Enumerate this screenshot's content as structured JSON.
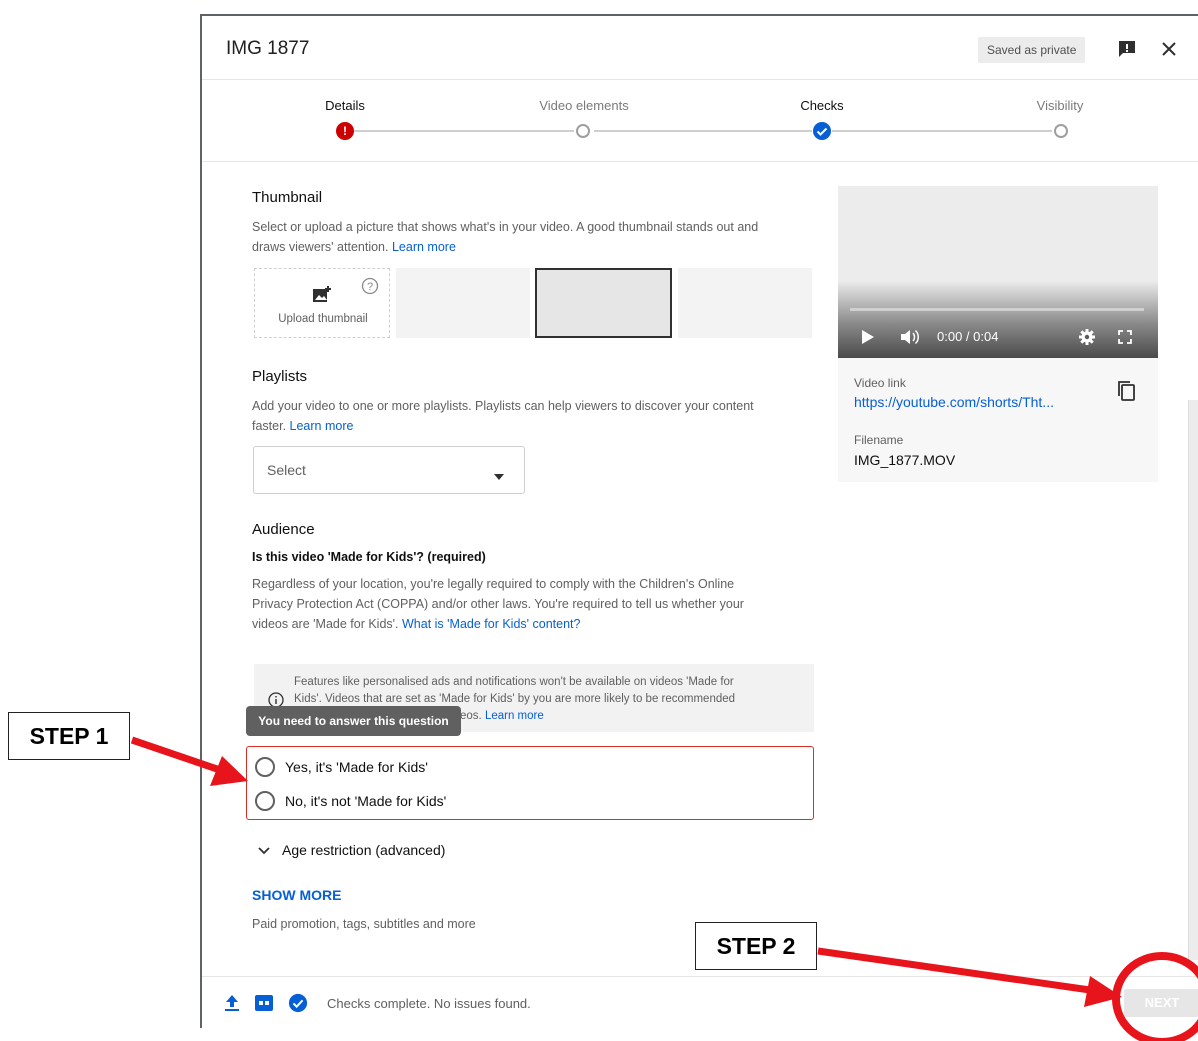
{
  "dialog": {
    "title": "IMG 1877",
    "saved_badge": "Saved as private"
  },
  "steps": [
    {
      "label": "Details",
      "state": "error"
    },
    {
      "label": "Video elements",
      "state": "pending"
    },
    {
      "label": "Checks",
      "state": "done"
    },
    {
      "label": "Visibility",
      "state": "pending"
    }
  ],
  "thumbnail": {
    "heading": "Thumbnail",
    "desc_line1": "Select or upload a picture that shows what's in your video. A good thumbnail stands out and",
    "desc_line2": "draws viewers' attention.",
    "learn_more": "Learn more",
    "upload_label": "Upload thumbnail"
  },
  "playlists": {
    "heading": "Playlists",
    "desc_line1": "Add your video to one or more playlists. Playlists can help viewers to discover your content",
    "desc_line2": "faster.",
    "learn_more": "Learn more",
    "select_placeholder": "Select"
  },
  "audience": {
    "heading": "Audience",
    "question": "Is this video 'Made for Kids'? (required)",
    "desc_line1": "Regardless of your location, you're legally required to comply with the Children's Online",
    "desc_line2": "Privacy Protection Act (COPPA) and/or other laws. You're required to tell us whether your",
    "desc_line3": "videos are 'Made for Kids'.",
    "what_is_link": "What is 'Made for Kids' content?",
    "info_line1": "Features like personalised ads and notifications won't be available on videos 'Made for",
    "info_line2": "Kids'. Videos that are set as 'Made for Kids' by you are more likely to be recommended",
    "info_line3_tail": "eos.",
    "info_learn_more": "Learn more",
    "tooltip": "You need to answer this question",
    "option_yes": "Yes, it's 'Made for Kids'",
    "option_no": "No, it's not 'Made for Kids'"
  },
  "age_restriction": "Age restriction (advanced)",
  "show_more": {
    "label": "SHOW MORE",
    "desc": "Paid promotion, tags, subtitles and more"
  },
  "preview": {
    "time": "0:00 / 0:04",
    "video_link_label": "Video link",
    "video_link": "https://youtube.com/shorts/Tht...",
    "filename_label": "Filename",
    "filename": "IMG_1877.MOV"
  },
  "footer": {
    "status": "Checks complete. No issues found.",
    "next_label": "NEXT"
  },
  "annotations": {
    "step1": "STEP 1",
    "step2": "STEP 2"
  },
  "colors": {
    "accent": "#065fd4",
    "error": "#cc0000",
    "annotation_red": "#e8141c"
  }
}
